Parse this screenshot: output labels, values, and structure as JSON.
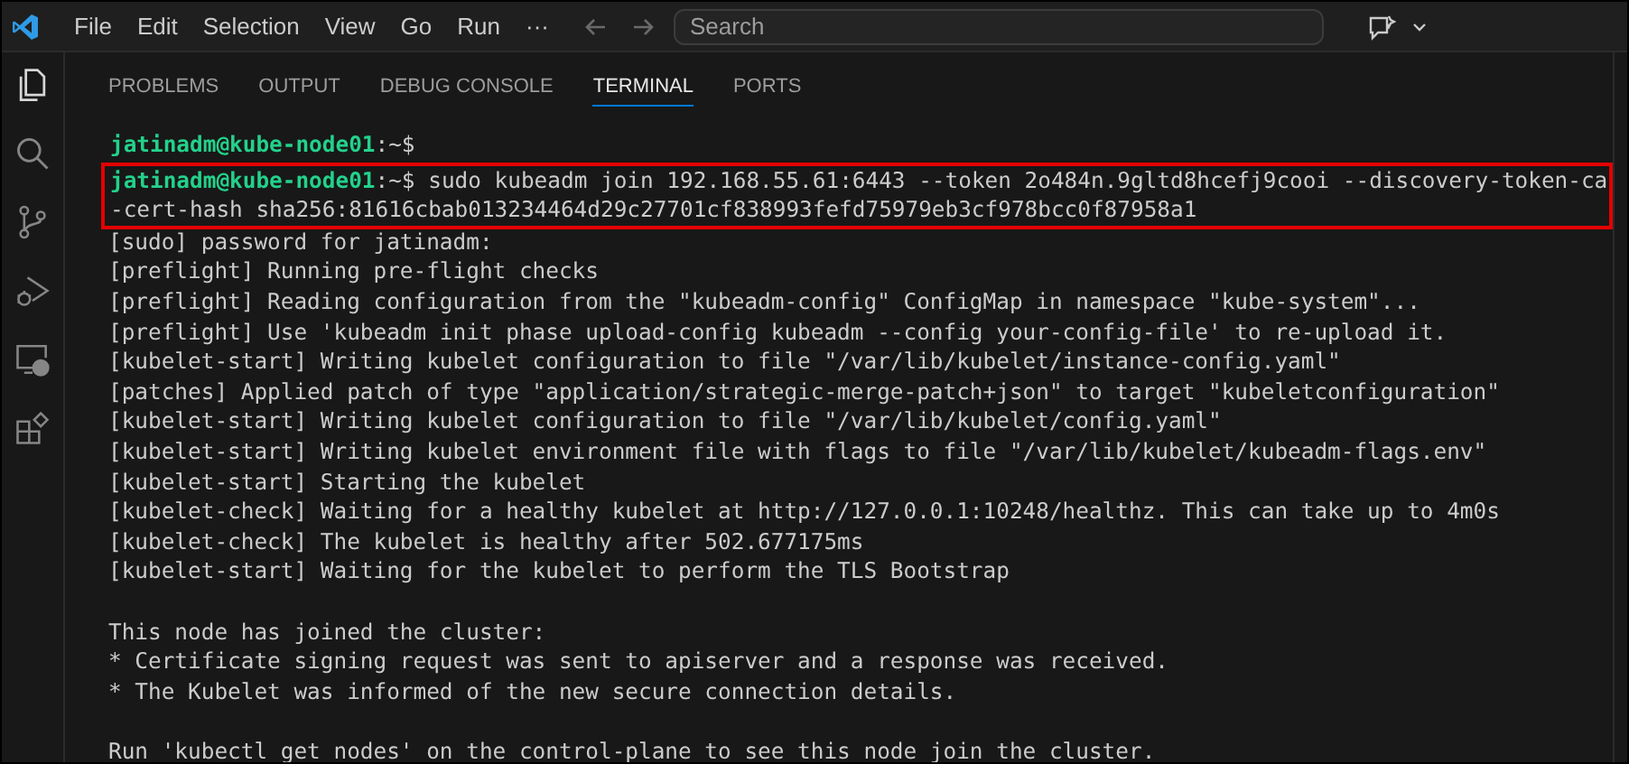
{
  "menu_bar": {
    "items": [
      "File",
      "Edit",
      "Selection",
      "View",
      "Go",
      "Run"
    ],
    "overflow": "···",
    "search": {
      "placeholder": "Search"
    }
  },
  "activity_bar": {
    "items": [
      {
        "kind": "explorer",
        "selected": true
      },
      {
        "kind": "search",
        "selected": false
      },
      {
        "kind": "source-control",
        "selected": false
      },
      {
        "kind": "run-debug",
        "selected": false
      },
      {
        "kind": "remote",
        "selected": false
      },
      {
        "kind": "extensions",
        "selected": false
      }
    ]
  },
  "panel": {
    "tabs": [
      {
        "label": "PROBLEMS",
        "selected": false
      },
      {
        "label": "OUTPUT",
        "selected": false
      },
      {
        "label": "DEBUG CONSOLE",
        "selected": false
      },
      {
        "label": "TERMINAL",
        "selected": true
      },
      {
        "label": "PORTS",
        "selected": false
      }
    ]
  },
  "terminal": {
    "lines": [
      {
        "kind": "prompt",
        "user_host": "jatinadm@kube-node01",
        "path": ":~$",
        "highlighted": false
      },
      {
        "kind": "prompt",
        "user_host": "jatinadm@kube-node01",
        "path": ":~$",
        "command": "sudo kubeadm join 192.168.55.61:6443 --token 2o484n.9gltd8hcefj9cooi --discovery-token-ca",
        "continuation": "-cert-hash sha256:81616cbab013234464d29c27701cf838993fefd75979eb3cf978bcc0f87958a1",
        "highlighted": true
      },
      {
        "kind": "output",
        "text": "[sudo] password for jatinadm:"
      },
      {
        "kind": "output",
        "text": "[preflight] Running pre-flight checks"
      },
      {
        "kind": "output",
        "text": "[preflight] Reading configuration from the \"kubeadm-config\" ConfigMap in namespace \"kube-system\"..."
      },
      {
        "kind": "output",
        "text": "[preflight] Use 'kubeadm init phase upload-config kubeadm --config your-config-file' to re-upload it."
      },
      {
        "kind": "output",
        "text": "[kubelet-start] Writing kubelet configuration to file \"/var/lib/kubelet/instance-config.yaml\""
      },
      {
        "kind": "output",
        "text": "[patches] Applied patch of type \"application/strategic-merge-patch+json\" to target \"kubeletconfiguration\""
      },
      {
        "kind": "output",
        "text": "[kubelet-start] Writing kubelet configuration to file \"/var/lib/kubelet/config.yaml\""
      },
      {
        "kind": "output",
        "text": "[kubelet-start] Writing kubelet environment file with flags to file \"/var/lib/kubelet/kubeadm-flags.env\""
      },
      {
        "kind": "output",
        "text": "[kubelet-start] Starting the kubelet"
      },
      {
        "kind": "output",
        "text": "[kubelet-check] Waiting for a healthy kubelet at http://127.0.0.1:10248/healthz. This can take up to 4m0s"
      },
      {
        "kind": "output",
        "text": "[kubelet-check] The kubelet is healthy after 502.677175ms"
      },
      {
        "kind": "output",
        "text": "[kubelet-start] Waiting for the kubelet to perform the TLS Bootstrap"
      },
      {
        "kind": "blank"
      },
      {
        "kind": "output",
        "text": "This node has joined the cluster:"
      },
      {
        "kind": "output",
        "text": "* Certificate signing request was sent to apiserver and a response was received."
      },
      {
        "kind": "output",
        "text": "* The Kubelet was informed of the new secure connection details."
      },
      {
        "kind": "blank"
      },
      {
        "kind": "output",
        "text": "Run 'kubectl get nodes' on the control-plane to see this node join the cluster."
      }
    ]
  }
}
